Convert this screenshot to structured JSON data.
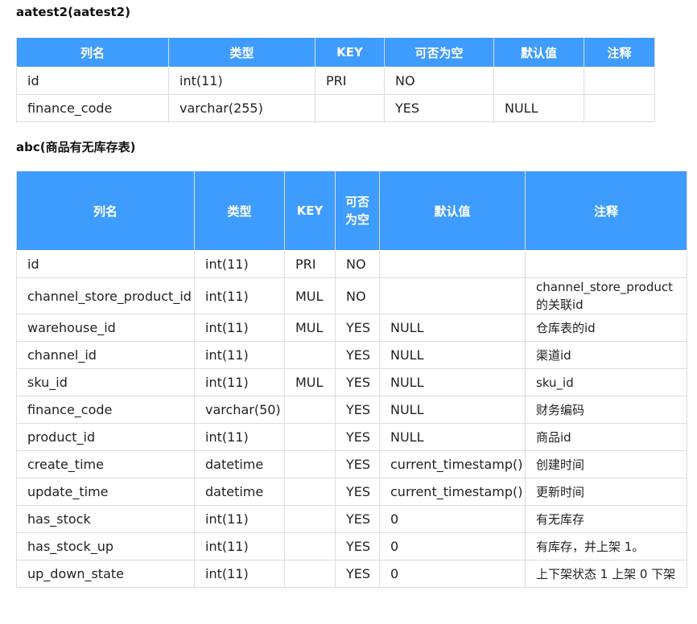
{
  "table1": {
    "title": "aatest2(aatest2)",
    "headers": [
      "列名",
      "类型",
      "KEY",
      "可否为空",
      "默认值",
      "注释"
    ],
    "rows": [
      [
        "id",
        "int(11)",
        "PRI",
        "NO",
        "",
        ""
      ],
      [
        "finance_code",
        "varchar(255)",
        "",
        "YES",
        "NULL",
        ""
      ]
    ]
  },
  "table2": {
    "title": "abc(商品有无库存表)",
    "headers": [
      "列名",
      "类型",
      "KEY",
      "可否为空",
      "默认值",
      "注释"
    ],
    "rows": [
      [
        "id",
        "int(11)",
        "PRI",
        "NO",
        "",
        ""
      ],
      [
        "channel_store_product_id",
        "int(11)",
        "MUL",
        "NO",
        "",
        "channel_store_product的关联id"
      ],
      [
        "warehouse_id",
        "int(11)",
        "MUL",
        "YES",
        "NULL",
        "仓库表的id"
      ],
      [
        "channel_id",
        "int(11)",
        "",
        "YES",
        "NULL",
        "渠道id"
      ],
      [
        "sku_id",
        "int(11)",
        "MUL",
        "YES",
        "NULL",
        "sku_id"
      ],
      [
        "finance_code",
        "varchar(50)",
        "",
        "YES",
        "NULL",
        "财务编码"
      ],
      [
        "product_id",
        "int(11)",
        "",
        "YES",
        "NULL",
        "商品id"
      ],
      [
        "create_time",
        "datetime",
        "",
        "YES",
        "current_timestamp()",
        "创建时间"
      ],
      [
        "update_time",
        "datetime",
        "",
        "YES",
        "current_timestamp()",
        "更新时间"
      ],
      [
        "has_stock",
        "int(11)",
        "",
        "YES",
        "0",
        "有无库存"
      ],
      [
        "has_stock_up",
        "int(11)",
        "",
        "YES",
        "0",
        "有库存，并上架 1。"
      ],
      [
        "up_down_state",
        "int(11)",
        "",
        "YES",
        "0",
        "上下架状态 1 上架 0 下架"
      ]
    ]
  }
}
